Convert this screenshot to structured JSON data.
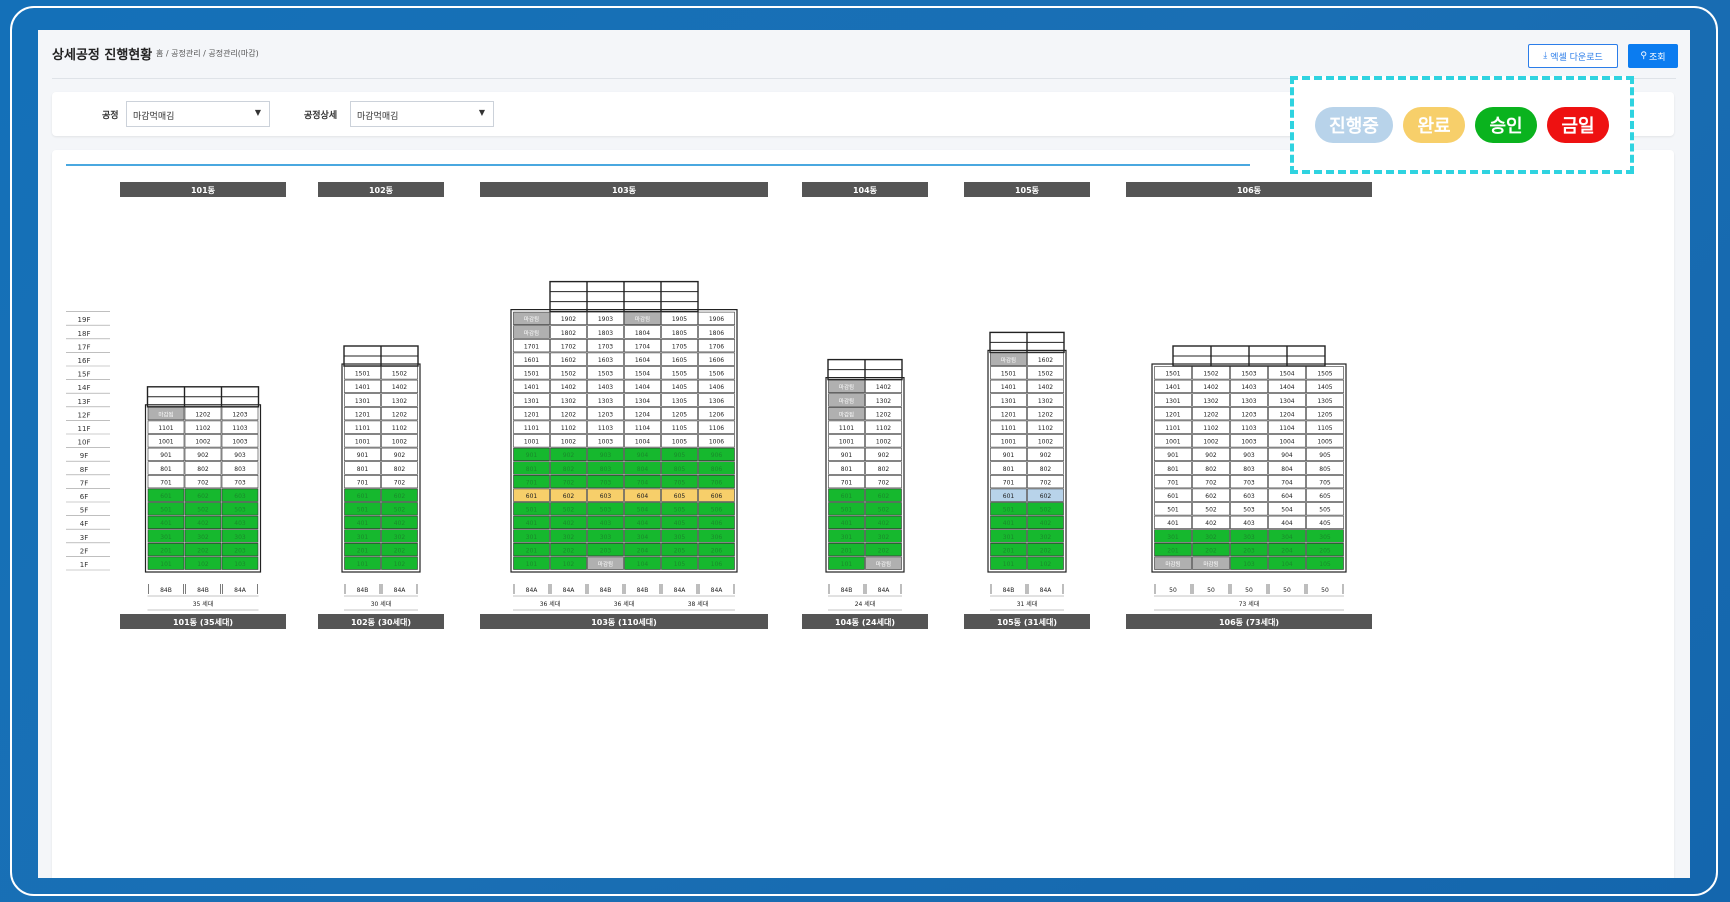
{
  "header": {
    "title": "상세공정 진행현황",
    "breadcrumb": "홈  /  공정관리  /  공정관리(마감)",
    "excel_label": "엑셀 다운로드",
    "search_label": "조회"
  },
  "filters": {
    "process_label": "공정",
    "process_value": "마감먹매김",
    "detail_label": "공정상세",
    "detail_value": "마감먹매김"
  },
  "legend": [
    {
      "label": "진행중",
      "color": "#b8d3ea"
    },
    {
      "label": "완료",
      "color": "#f7cf6a"
    },
    {
      "label": "승인",
      "color": "#0ab31e"
    },
    {
      "label": "금일",
      "color": "#ee1111"
    }
  ],
  "colors": {
    "approved": "#16b82e",
    "done": "#f7cf6a",
    "progress": "#b8d3ea",
    "closed": "#b0b0b0",
    "header": "#555555"
  },
  "floor_labels": [
    "19F",
    "18F",
    "17F",
    "16F",
    "15F",
    "14F",
    "13F",
    "12F",
    "11F",
    "10F",
    "9F",
    "8F",
    "7F",
    "6F",
    "5F",
    "4F",
    "3F",
    "2F",
    "1F"
  ],
  "buildings": [
    {
      "name": "101동",
      "footer": "101동 (35세대)",
      "total": "35 세대",
      "floors": 12,
      "roofRows": 2,
      "types": [
        "84B",
        "84B",
        "84A"
      ],
      "groups": [],
      "green": {
        "1": [
          1,
          2,
          3
        ],
        "2": [
          1,
          2,
          3
        ],
        "3": [
          1,
          2,
          3
        ],
        "4": [
          1,
          2,
          3
        ],
        "5": [
          1,
          2,
          3
        ],
        "6": [
          1,
          2,
          3
        ]
      },
      "labels": {
        "12-1": "마감됨"
      }
    },
    {
      "name": "102동",
      "footer": "102동 (30세대)",
      "total": "30 세대",
      "floors": 15,
      "roofRows": 2,
      "types": [
        "84B",
        "84A"
      ],
      "groups": [],
      "green": {
        "1": [
          1,
          2
        ],
        "2": [
          1,
          2
        ],
        "3": [
          1,
          2
        ],
        "4": [
          1,
          2
        ],
        "5": [
          1,
          2
        ],
        "6": [
          1,
          2
        ]
      },
      "labels": {}
    },
    {
      "name": "103동",
      "footer": "103동 (110세대)",
      "total": "",
      "floors": 19,
      "roofRows": 3,
      "types": [
        "84A",
        "84A",
        "84B",
        "84B",
        "84A",
        "84A"
      ],
      "groups": [
        {
          "label": "36 세대",
          "span": 2
        },
        {
          "label": "36 세대",
          "span": 2
        },
        {
          "label": "38 세대",
          "span": 2
        }
      ],
      "green": {
        "1": [
          1,
          2,
          4,
          5,
          6
        ],
        "2": [
          1,
          2,
          3,
          4,
          5,
          6
        ],
        "3": [
          1,
          2,
          3,
          4,
          5,
          6
        ],
        "4": [
          1,
          2,
          3,
          4,
          5,
          6
        ],
        "5": [
          1,
          2,
          3,
          4,
          5,
          6
        ],
        "7": [
          1,
          2,
          3,
          4,
          5,
          6
        ],
        "8": [
          1,
          2,
          3,
          4,
          5,
          6
        ],
        "9": [
          1,
          2,
          3,
          4,
          5,
          6
        ]
      },
      "yellow": {
        "6": [
          1,
          2,
          3,
          4,
          5,
          6
        ]
      },
      "labels": {
        "19-1": "마감됨",
        "19-4": "마감됨",
        "18-1": "마감됨",
        "1-3": "마감됨"
      }
    },
    {
      "name": "104동",
      "footer": "104동 (24세대)",
      "total": "24 세대",
      "floors": 14,
      "roofRows": 2,
      "types": [
        "84B",
        "84A"
      ],
      "groups": [],
      "green": {
        "1": [
          1
        ],
        "2": [
          1,
          2
        ],
        "3": [
          1,
          2
        ],
        "4": [
          1,
          2
        ],
        "5": [
          1,
          2
        ],
        "6": [
          1,
          2
        ]
      },
      "labels": {
        "14-1": "마감됨",
        "13-1": "마감됨",
        "12-1": "마감됨",
        "1-2": "마감됨"
      }
    },
    {
      "name": "105동",
      "footer": "105동 (31세대)",
      "total": "31 세대",
      "floors": 16,
      "roofRows": 2,
      "types": [
        "84B",
        "84A"
      ],
      "groups": [],
      "green": {
        "1": [
          1,
          2
        ],
        "2": [
          1,
          2
        ],
        "3": [
          1,
          2
        ],
        "4": [
          1,
          2
        ],
        "5": [
          1,
          2
        ]
      },
      "blue": {
        "6": [
          1,
          2
        ]
      },
      "labels": {
        "16-1": "마감됨"
      }
    },
    {
      "name": "106동",
      "footer": "106동 (73세대)",
      "total": "73 세대",
      "floors": 15,
      "roofRows": 2,
      "types": [
        "50",
        "50",
        "50",
        "50",
        "50"
      ],
      "groups": [],
      "green": {
        "1": [
          3,
          4,
          5
        ],
        "2": [
          1,
          2,
          3,
          4,
          5
        ],
        "3": [
          1,
          2,
          3,
          4,
          5
        ]
      },
      "labels": {
        "1-1": "마감됨",
        "1-2": "마감됨"
      }
    }
  ]
}
